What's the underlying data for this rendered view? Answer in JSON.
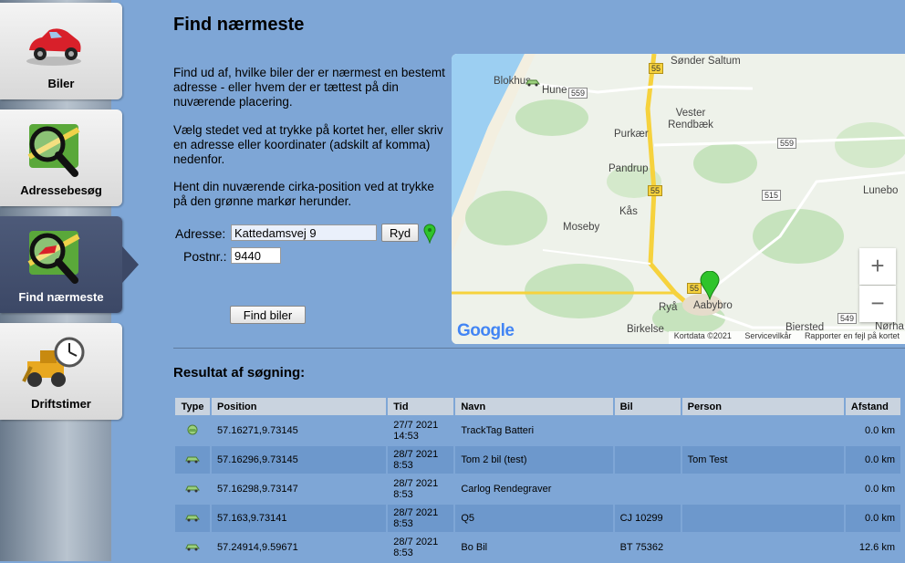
{
  "nav": {
    "items": [
      {
        "label": "Biler",
        "icon": "car-icon"
      },
      {
        "label": "Adressebesøg",
        "icon": "address-magnifier-icon"
      },
      {
        "label": "Find nærmeste",
        "icon": "find-nearest-icon"
      },
      {
        "label": "Driftstimer",
        "icon": "operating-hours-icon"
      }
    ],
    "active_index": 2
  },
  "page": {
    "title": "Find nærmeste",
    "para1": "Find ud af, hvilke biler der er nærmest en bestemt adresse - eller hvem der er tættest på din nuværende placering.",
    "para2": "Vælg stedet ved at trykke på kortet her, eller skriv en adresse eller koordinater (adskilt af komma) nedenfor.",
    "para3": "Hent din nuværende cirka-position ved at trykke på den grønne markør herunder."
  },
  "form": {
    "address_label": "Adresse:",
    "address_value": "Kattedamsvej 9",
    "clear_label": "Ryd",
    "postal_label": "Postnr.:",
    "postal_value": "9440",
    "submit_label": "Find biler"
  },
  "map": {
    "places": [
      "Sønder Saltum",
      "Blokhus",
      "Hune",
      "Vester Rendbæk",
      "Purkær",
      "Pandrup",
      "Lunebo",
      "Kås",
      "Moseby",
      "Ryå",
      "Aabybro",
      "Birkelse",
      "Biersted",
      "Nørha"
    ],
    "roads": [
      "55",
      "559",
      "559",
      "55",
      "515",
      "55",
      "549"
    ],
    "google": "Google",
    "footer_data": "Kortdata ©2021",
    "footer_terms": "Servicevilkår",
    "footer_report": "Rapporter en fejl på kortet",
    "zoom_in": "+",
    "zoom_out": "−"
  },
  "results": {
    "title": "Resultat af søgning:",
    "headers": [
      "Type",
      "Position",
      "Tid",
      "Navn",
      "Bil",
      "Person",
      "Afstand"
    ],
    "rows": [
      {
        "type": "car-icon",
        "position": "57.16271,9.73145",
        "date": "27/7 2021",
        "time": "14:53",
        "name": "TrackTag Batteri",
        "car": "",
        "person": "",
        "distance": "0.0 km"
      },
      {
        "type": "car-icon",
        "position": "57.16296,9.73145",
        "date": "28/7 2021",
        "time": "8:53",
        "name": "Tom 2 bil (test)",
        "car": "",
        "person": "Tom Test",
        "distance": "0.0 km"
      },
      {
        "type": "car-icon",
        "position": "57.16298,9.73147",
        "date": "28/7 2021",
        "time": "8:53",
        "name": "Carlog Rendegraver",
        "car": "",
        "person": "",
        "distance": "0.0 km"
      },
      {
        "type": "car-icon",
        "position": "57.163,9.73141",
        "date": "28/7 2021",
        "time": "8:53",
        "name": "Q5",
        "car": "CJ 10299",
        "person": "",
        "distance": "0.0 km"
      },
      {
        "type": "car-icon",
        "position": "57.24914,9.59671",
        "date": "28/7 2021",
        "time": "8:53",
        "name": "Bo Bil",
        "car": "BT 75362",
        "person": "",
        "distance": "12.6 km"
      }
    ]
  },
  "colors": {
    "background": "#7ea6d6",
    "active_nav": "#3c4866",
    "marker_green": "#2fc42b",
    "road_yellow": "#f6d23d"
  }
}
